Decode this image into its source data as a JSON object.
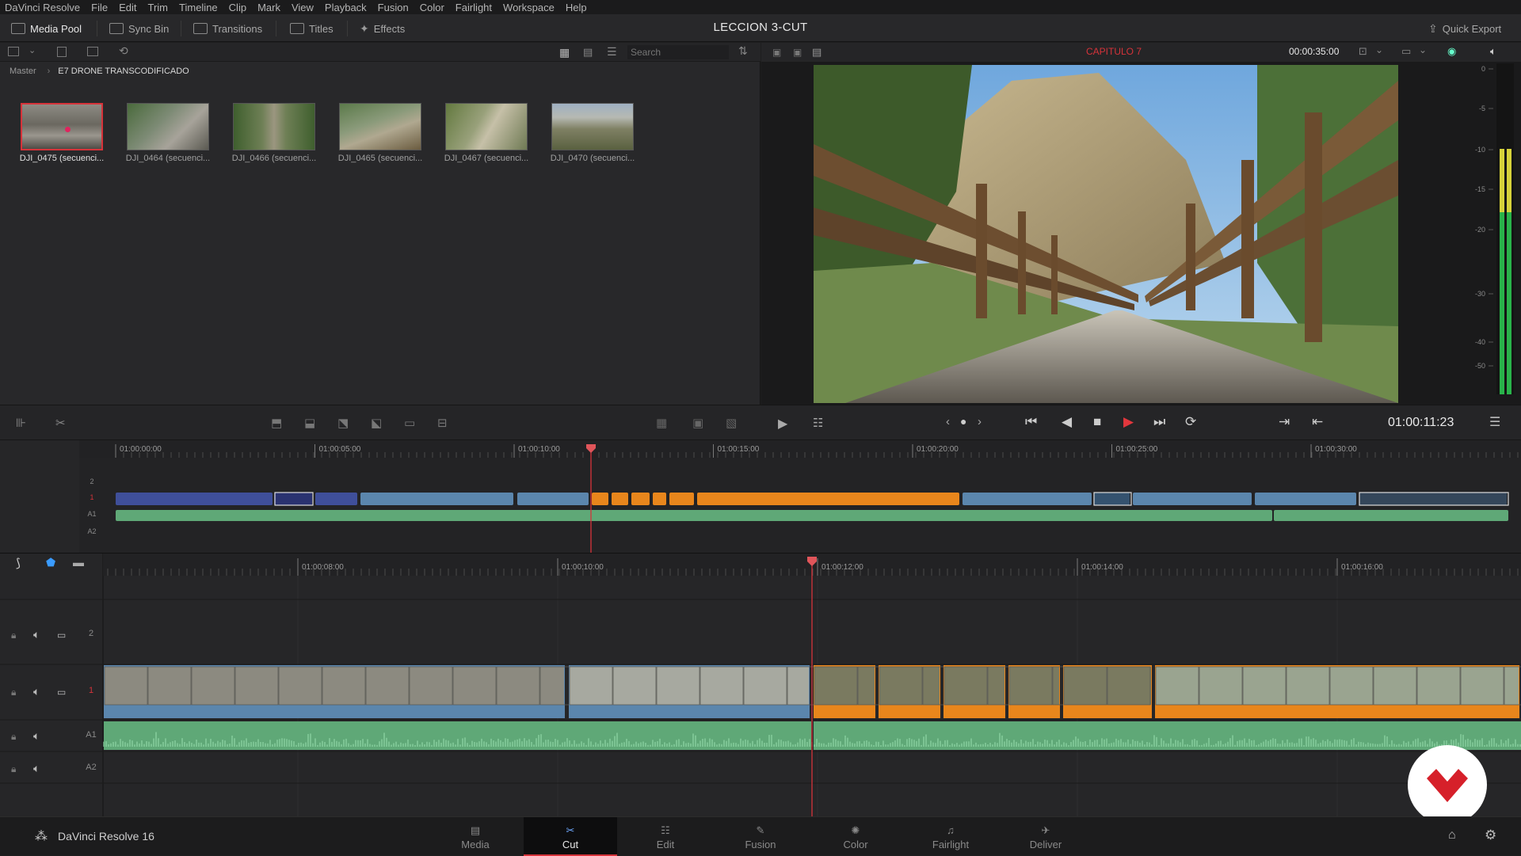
{
  "menubar": {
    "items": [
      "DaVinci Resolve",
      "File",
      "Edit",
      "Trim",
      "Timeline",
      "Clip",
      "Mark",
      "View",
      "Playback",
      "Fusion",
      "Color",
      "Fairlight",
      "Workspace",
      "Help"
    ]
  },
  "toolbar": {
    "media_pool": "Media Pool",
    "sync_bin": "Sync Bin",
    "transitions": "Transitions",
    "titles": "Titles",
    "effects": "Effects",
    "project_title": "LECCION 3-CUT",
    "quick_export": "Quick Export"
  },
  "mediapool": {
    "search_placeholder": "Search",
    "breadcrumb_root": "Master",
    "breadcrumb_current": "E7 DRONE TRANSCODIFICADO",
    "clips": [
      {
        "name": "DJI_0475 (secuenci...",
        "selected": true
      },
      {
        "name": "DJI_0464 (secuenci...",
        "selected": false
      },
      {
        "name": "DJI_0466 (secuenci...",
        "selected": false
      },
      {
        "name": "DJI_0465 (secuenci...",
        "selected": false
      },
      {
        "name": "DJI_0467 (secuenci...",
        "selected": false
      },
      {
        "name": "DJI_0470 (secuenci...",
        "selected": false
      }
    ]
  },
  "viewer": {
    "timeline_name": "CAPITULO 7",
    "duration": "00:00:35:00",
    "current_timecode": "01:00:11:23",
    "meter_scale": [
      "0",
      "-5",
      "-10",
      "-15",
      "-20",
      "-30",
      "-40",
      "-50"
    ]
  },
  "upper_timeline": {
    "ruler": [
      "01:00:00:00",
      "01:00:05:00",
      "01:00:10:00",
      "01:00:15:00",
      "01:00:20:00",
      "01:00:25:00",
      "01:00:30:00"
    ],
    "tracks": [
      "2",
      "1",
      "A1",
      "A2"
    ]
  },
  "lower_timeline": {
    "ruler": [
      "01:00:08:00",
      "01:00:10:00",
      "01:00:12:00",
      "01:00:14:00",
      "01:00:16:00"
    ],
    "tracks": [
      "2",
      "1",
      "A1",
      "A2"
    ]
  },
  "pagebar": {
    "app_name": "DaVinci Resolve 16",
    "pages": [
      "Media",
      "Cut",
      "Edit",
      "Fusion",
      "Color",
      "Fairlight",
      "Deliver"
    ],
    "active_page": "Cut"
  },
  "colors": {
    "accent": "#d6333a",
    "clip_blue": "#5b86ad",
    "clip_dark_blue": "#3f4f9a",
    "clip_orange": "#e8861c",
    "audio_green": "#5fa877"
  }
}
